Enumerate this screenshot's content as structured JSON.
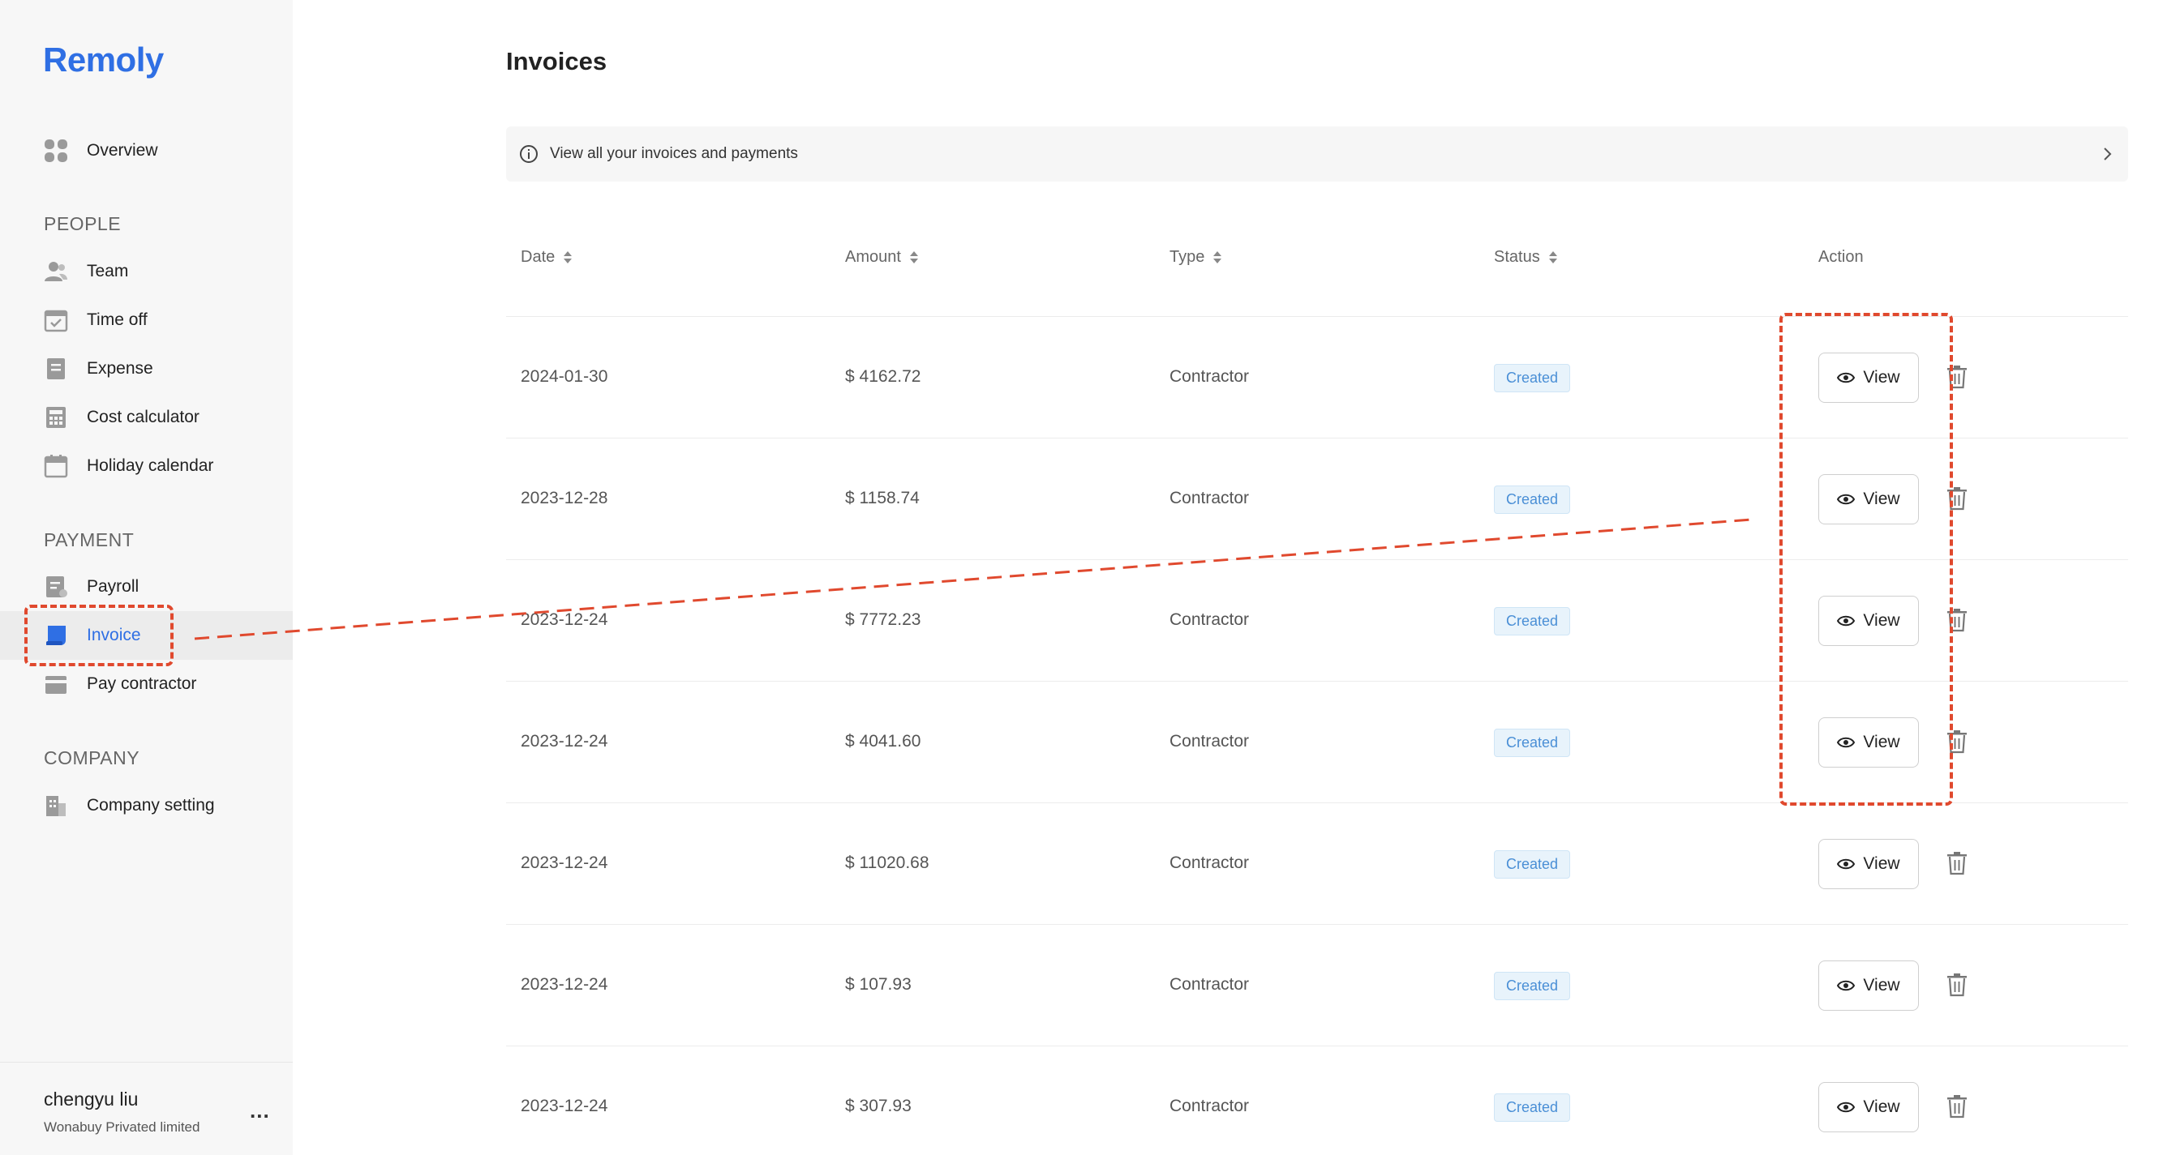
{
  "brand": {
    "name": "Remoly",
    "color": "#2f6fe4"
  },
  "sidebar": {
    "overview": {
      "label": "Overview",
      "icon": "grid-icon"
    },
    "sections": {
      "people": "PEOPLE",
      "payment": "PAYMENT",
      "company": "COMPANY"
    },
    "people_items": [
      {
        "label": "Team",
        "icon": "users-icon"
      },
      {
        "label": "Time off",
        "icon": "calendar-check-icon"
      },
      {
        "label": "Expense",
        "icon": "receipt-icon"
      },
      {
        "label": "Cost calculator",
        "icon": "calculator-icon"
      },
      {
        "label": "Holiday calendar",
        "icon": "calendar-icon"
      }
    ],
    "payment_items": [
      {
        "label": "Payroll",
        "icon": "payroll-icon"
      },
      {
        "label": "Invoice",
        "icon": "invoice-icon",
        "active": true
      },
      {
        "label": "Pay contractor",
        "icon": "wallet-icon"
      }
    ],
    "company_items": [
      {
        "label": "Company setting",
        "icon": "building-icon"
      }
    ],
    "user": {
      "name": "chengyu liu",
      "org": "Wonabuy Privated limited",
      "more": "..."
    }
  },
  "main": {
    "title": "Invoices",
    "info": "View all your invoices and payments",
    "columns": {
      "date": "Date",
      "amount": "Amount",
      "type": "Type",
      "status": "Status",
      "action": "Action"
    },
    "view_label": "View",
    "rows": [
      {
        "date": "2024-01-30",
        "amount": "$ 4162.72",
        "type": "Contractor",
        "status": "Created"
      },
      {
        "date": "2023-12-28",
        "amount": "$ 1158.74",
        "type": "Contractor",
        "status": "Created"
      },
      {
        "date": "2023-12-24",
        "amount": "$ 7772.23",
        "type": "Contractor",
        "status": "Created"
      },
      {
        "date": "2023-12-24",
        "amount": "$ 4041.60",
        "type": "Contractor",
        "status": "Created"
      },
      {
        "date": "2023-12-24",
        "amount": "$ 11020.68",
        "type": "Contractor",
        "status": "Created"
      },
      {
        "date": "2023-12-24",
        "amount": "$ 107.93",
        "type": "Contractor",
        "status": "Created"
      },
      {
        "date": "2023-12-24",
        "amount": "$ 307.93",
        "type": "Contractor",
        "status": "Created"
      }
    ]
  },
  "colors": {
    "accent": "#2f6fe4",
    "badge_text": "#4a8fd6",
    "badge_bg": "#e8f3fb",
    "annotation": "#e0492e"
  }
}
